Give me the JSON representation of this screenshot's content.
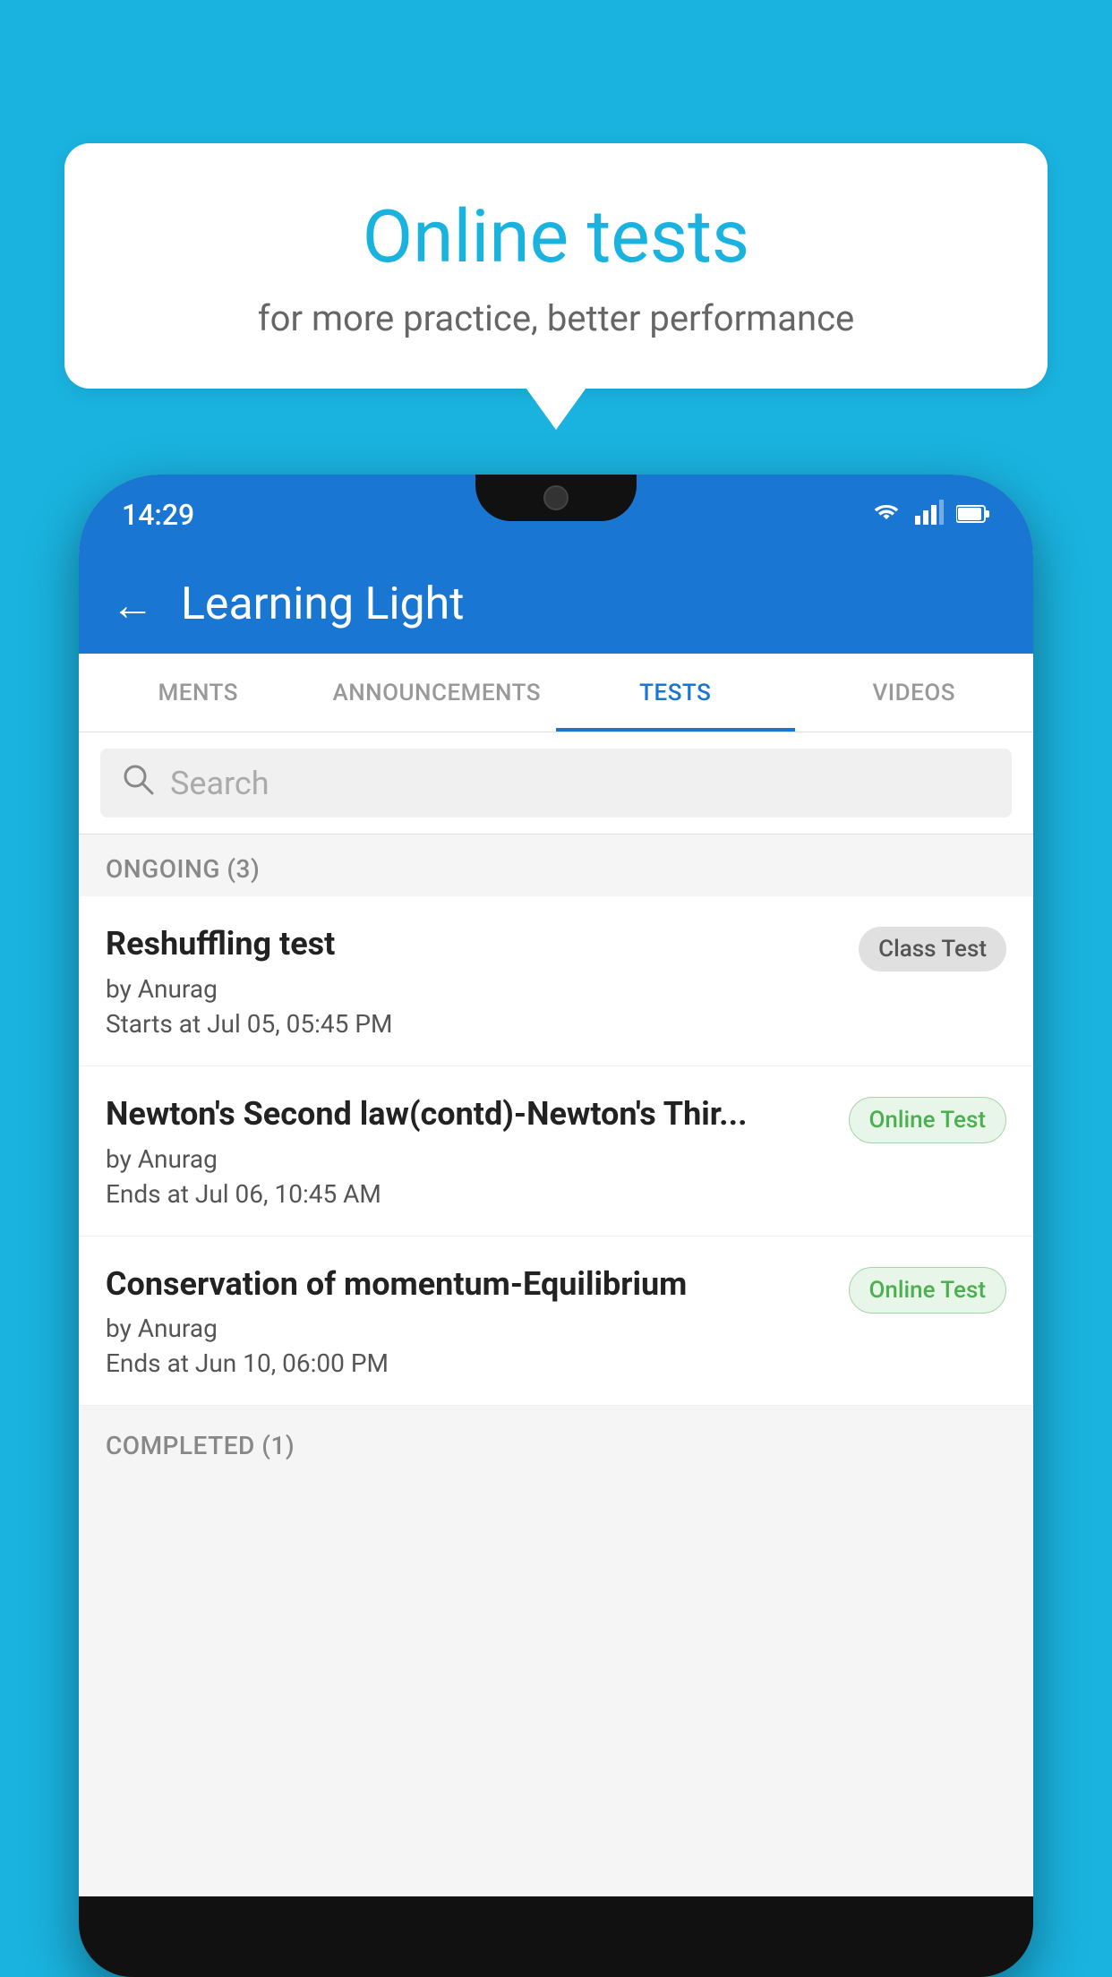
{
  "background": {
    "color": "#1ab3e0"
  },
  "speech_bubble": {
    "title": "Online tests",
    "subtitle": "for more practice, better performance"
  },
  "phone": {
    "status_bar": {
      "time": "14:29",
      "wifi_icon": "wifi",
      "signal_icon": "signal",
      "battery_icon": "battery"
    },
    "app_header": {
      "back_label": "←",
      "title": "Learning Light"
    },
    "tabs": [
      {
        "label": "MENTS",
        "active": false
      },
      {
        "label": "ANNOUNCEMENTS",
        "active": false
      },
      {
        "label": "TESTS",
        "active": true
      },
      {
        "label": "VIDEOS",
        "active": false
      }
    ],
    "search": {
      "placeholder": "Search"
    },
    "ongoing_section": {
      "label": "ONGOING (3)"
    },
    "tests": [
      {
        "name": "Reshuffling test",
        "author": "by Anurag",
        "date_label": "Starts at",
        "date": "Jul 05, 05:45 PM",
        "badge": "Class Test",
        "badge_type": "class"
      },
      {
        "name": "Newton's Second law(contd)-Newton's Thir...",
        "author": "by Anurag",
        "date_label": "Ends at",
        "date": "Jul 06, 10:45 AM",
        "badge": "Online Test",
        "badge_type": "online"
      },
      {
        "name": "Conservation of momentum-Equilibrium",
        "author": "by Anurag",
        "date_label": "Ends at",
        "date": "Jun 10, 06:00 PM",
        "badge": "Online Test",
        "badge_type": "online"
      }
    ],
    "completed_section": {
      "label": "COMPLETED (1)"
    }
  }
}
